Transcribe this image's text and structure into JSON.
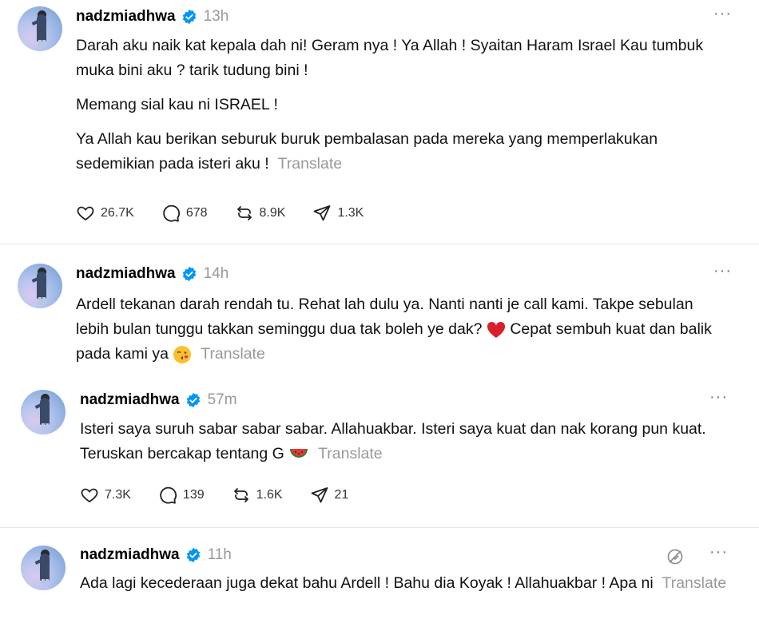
{
  "posts": [
    {
      "username": "nadzmiadhwa",
      "time": "13h",
      "paragraphs": [
        "Darah aku naik kat kepala dah ni! Geram nya ! Ya Allah ! Syaitan Haram Israel Kau tumbuk muka bini aku ? tarik tudung bini !",
        "Memang sial kau ni ISRAEL !",
        "Ya Allah kau berikan seburuk buruk pembalasan pada mereka yang memperlakukan sedemikian pada isteri aku !"
      ],
      "translate": "Translate",
      "likes": "26.7K",
      "replies": "678",
      "reposts": "8.9K",
      "shares": "1.3K"
    },
    {
      "username": "nadzmiadhwa",
      "time": "14h",
      "text_a": "Ardell tekanan darah rendah tu. Rehat lah dulu ya. Nanti nanti je call kami. Takpe sebulan lebih bulan tunggu takkan seminggu dua tak boleh ye dak?",
      "text_b": "Cepat sembuh kuat dan balik pada kami ya",
      "translate": "Translate"
    },
    {
      "username": "nadzmiadhwa",
      "time": "57m",
      "text_a": "Isteri saya suruh sabar sabar sabar. Allahuakbar. Isteri saya kuat dan nak korang pun kuat. Teruskan bercakap tentang G",
      "translate": "Translate",
      "likes": "7.3K",
      "replies": "139",
      "reposts": "1.6K",
      "shares": "21"
    },
    {
      "username": "nadzmiadhwa",
      "time": "11h",
      "text_a": "Ada lagi kecederaan juga dekat bahu Ardell ! Bahu dia Koyak ! Allahuakbar ! Apa ni",
      "translate": "Translate"
    }
  ],
  "more_icon": "···",
  "colors": {
    "verified": "#0095f6",
    "muted": "#999999",
    "separator": "#e6e6e6"
  }
}
